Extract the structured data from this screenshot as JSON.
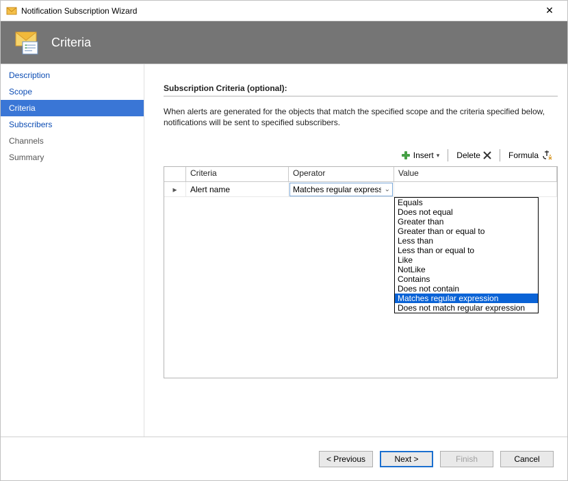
{
  "window": {
    "title": "Notification Subscription Wizard"
  },
  "header": {
    "title": "Criteria"
  },
  "sidebar": {
    "items": [
      {
        "label": "Description",
        "state": "visited"
      },
      {
        "label": "Scope",
        "state": "visited"
      },
      {
        "label": "Criteria",
        "state": "active"
      },
      {
        "label": "Subscribers",
        "state": "visited"
      },
      {
        "label": "Channels",
        "state": "future"
      },
      {
        "label": "Summary",
        "state": "future"
      }
    ]
  },
  "content": {
    "section_title": "Subscription Criteria (optional):",
    "description": "When alerts are generated for the objects that match the specified scope and the criteria specified below, notifications will be sent to specified subscribers."
  },
  "toolbar": {
    "insert": "Insert",
    "delete": "Delete",
    "formula": "Formula"
  },
  "grid": {
    "headers": {
      "criteria": "Criteria",
      "operator": "Operator",
      "value": "Value"
    },
    "row": {
      "criteria": "Alert name",
      "operator_display": "Matches regular expression",
      "value": ""
    }
  },
  "operator_options": [
    "Equals",
    "Does not equal",
    "Greater than",
    "Greater than or equal to",
    "Less than",
    "Less than or equal to",
    "Like",
    "NotLike",
    "Contains",
    "Does not contain",
    "Matches regular expression",
    "Does not match regular expression"
  ],
  "operator_selected_index": 10,
  "footer": {
    "previous": "< Previous",
    "next": "Next >",
    "finish": "Finish",
    "cancel": "Cancel"
  }
}
